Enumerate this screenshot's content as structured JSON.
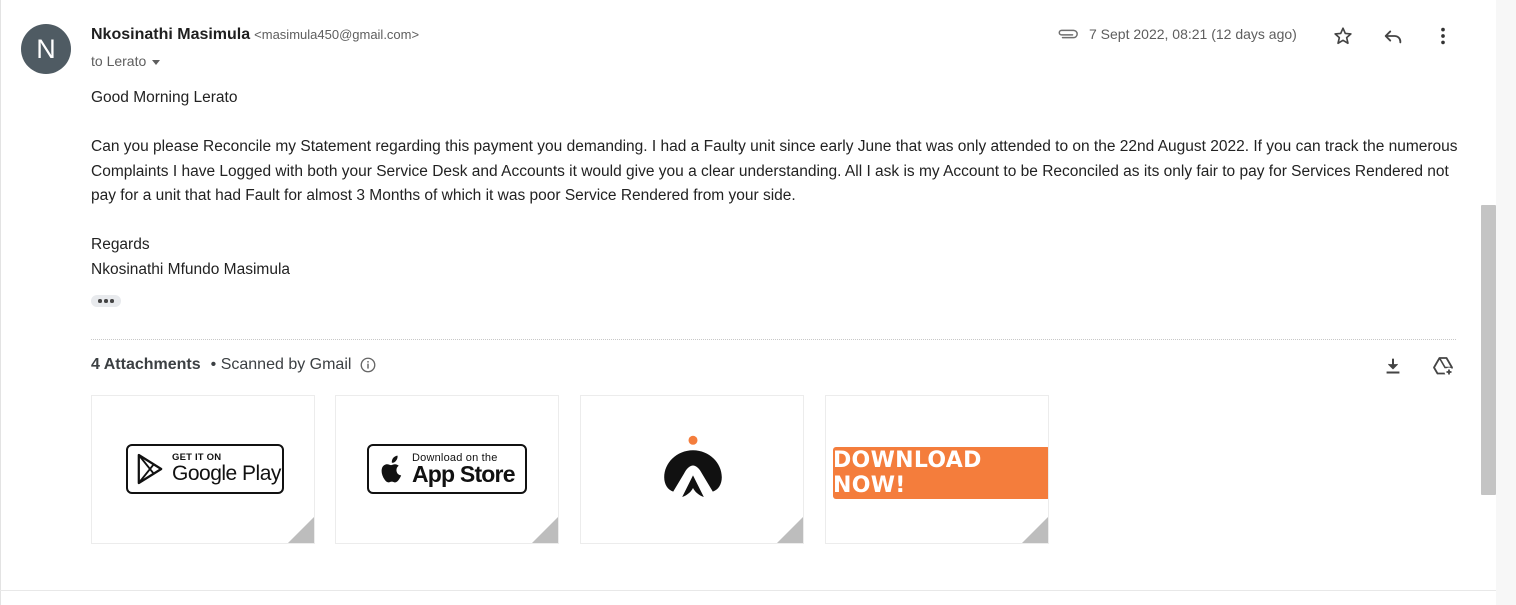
{
  "sender": {
    "initial": "N",
    "name": "Nkosinathi Masimula",
    "email": "<masimula450@gmail.com>",
    "to": "to Lerato"
  },
  "meta": {
    "date": "7 Sept 2022, 08:21 (12 days ago)",
    "icons": [
      "attachment-icon",
      "star-icon",
      "reply-icon",
      "more-vert-icon"
    ]
  },
  "body": {
    "greeting": "Good Morning Lerato",
    "paragraph": "Can you please Reconcile my Statement regarding this payment you demanding. I had a Faulty unit since early June that was only attended to on the 22nd August 2022. If you can track the numerous Complaints I have Logged with both your Service Desk and Accounts it would give you a clear understanding. All I ask is my Account to be Reconciled as its only fair to pay for Services Rendered not pay for a unit that had Fault for almost 3 Months of which it was poor Service Rendered from your side.",
    "closing": "Regards",
    "signature": "Nkosinathi Mfundo Masimula"
  },
  "attachments": {
    "count_label": "4 Attachments",
    "scan_label": "• Scanned by Gmail",
    "items": [
      {
        "small": "GET IT ON",
        "big": "Google Play",
        "icon": "google-play-icon"
      },
      {
        "small": "Download on the",
        "big": "App Store",
        "icon": "apple-icon"
      },
      {
        "icon": "app-logo-icon"
      },
      {
        "label": "DOWNLOAD NOW!"
      }
    ],
    "actions": [
      "download-all-icon",
      "add-to-drive-icon"
    ]
  },
  "colors": {
    "avatar": "#4f5b63",
    "download_button": "#f47d3c",
    "logo_dot": "#f47d3c"
  }
}
